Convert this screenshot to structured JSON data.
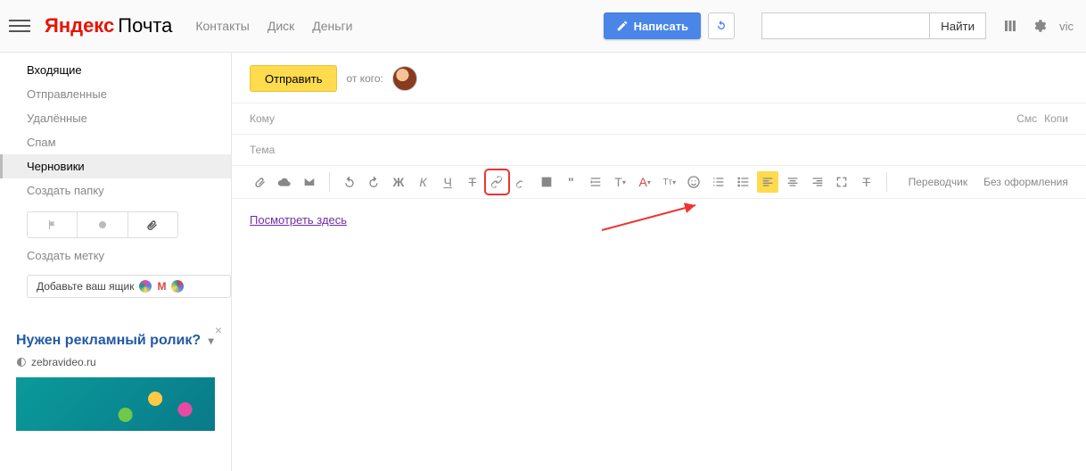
{
  "header": {
    "logo_service": "Яндекс",
    "logo_product": "Почта",
    "nav": {
      "contacts": "Контакты",
      "disk": "Диск",
      "money": "Деньги"
    },
    "compose": "Написать",
    "search_btn": "Найти",
    "user": "vic"
  },
  "sidebar": {
    "folders": {
      "inbox": "Входящие",
      "sent": "Отправленные",
      "trash": "Удалённые",
      "spam": "Спам",
      "drafts": "Черновики",
      "create_folder": "Создать папку"
    },
    "create_label": "Создать метку",
    "addbox": "Добавьте ваш ящик"
  },
  "ad": {
    "title": "Нужен рекламный ролик?",
    "url": "zebravideo.ru"
  },
  "compose": {
    "send": "Отправить",
    "from_label": "от кого:",
    "to_label": "Кому",
    "cc": "Смс",
    "bcc": "Копи",
    "subject_label": "Тема",
    "translator": "Переводчик",
    "plain": "Без оформления",
    "body_link": "Посмотреть здесь"
  }
}
